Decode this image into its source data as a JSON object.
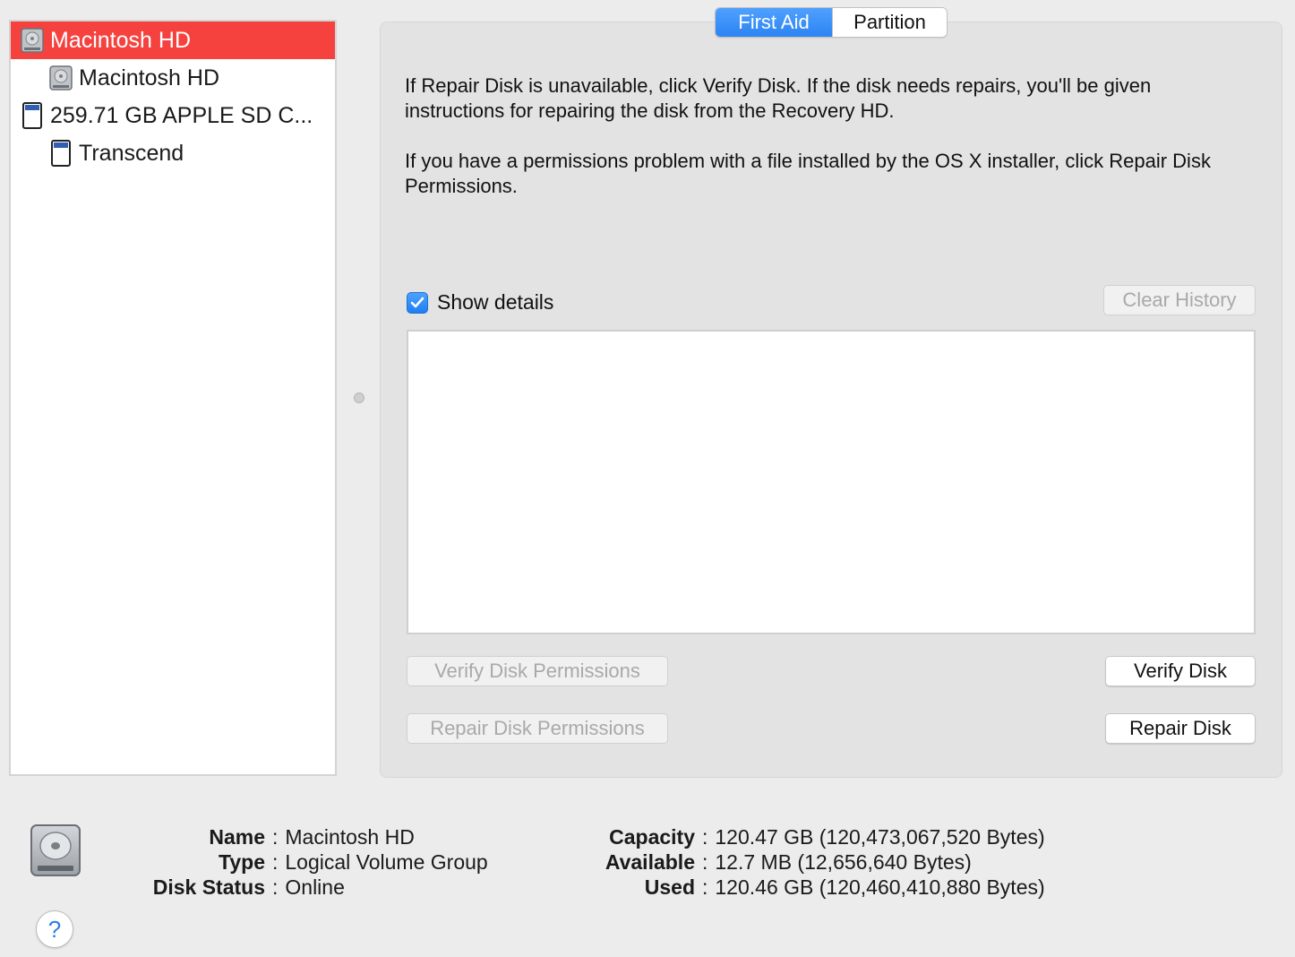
{
  "sidebar": {
    "items": [
      {
        "label": "Macintosh HD",
        "icon": "hard-disk-icon",
        "selected": true
      },
      {
        "label": "Macintosh HD",
        "icon": "hard-disk-icon",
        "selected": false
      },
      {
        "label": "259.71 GB APPLE SD C...",
        "icon": "sd-card-icon",
        "selected": false
      },
      {
        "label": "Transcend",
        "icon": "sd-card-icon",
        "selected": false
      }
    ]
  },
  "tabs": {
    "first_aid": "First Aid",
    "partition": "Partition"
  },
  "main": {
    "paragraph1": "If Repair Disk is unavailable, click Verify Disk. If the disk needs repairs, you'll be given instructions for repairing the disk from the Recovery HD.",
    "paragraph2": "If you have a permissions problem with a file installed by the OS X installer, click Repair Disk Permissions.",
    "show_details_label": "Show details",
    "show_details_checked": true,
    "clear_history": "Clear History",
    "verify_permissions": "Verify Disk Permissions",
    "repair_permissions": "Repair Disk Permissions",
    "verify_disk": "Verify Disk",
    "repair_disk": "Repair Disk"
  },
  "info": {
    "name_key": "Name",
    "name_value": "Macintosh HD",
    "type_key": "Type",
    "type_value": "Logical Volume Group",
    "status_key": "Disk Status",
    "status_value": "Online",
    "capacity_key": "Capacity",
    "capacity_value": "120.47 GB (120,473,067,520 Bytes)",
    "available_key": "Available",
    "available_value": "12.7 MB (12,656,640 Bytes)",
    "used_key": "Used",
    "used_value": "120.46 GB (120,460,410,880 Bytes)"
  },
  "help": "?",
  "colors": {
    "selection": "#f5423f",
    "accent": "#2c84f3",
    "disabled_text": "#a9a9a9"
  }
}
